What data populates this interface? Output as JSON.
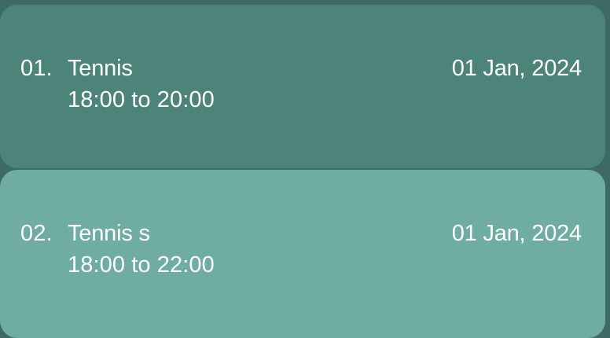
{
  "colors": {
    "background": "#3d6a62",
    "card_primary": "#4d847a",
    "card_secondary": "#6faca2",
    "text": "#ffffff"
  },
  "bookings": [
    {
      "index": "01.",
      "title": "Tennis",
      "time": "18:00 to 20:00",
      "date": "01 Jan, 2024"
    },
    {
      "index": "02.",
      "title": "Tennis s",
      "time": "18:00 to 22:00",
      "date": "01 Jan, 2024"
    }
  ]
}
